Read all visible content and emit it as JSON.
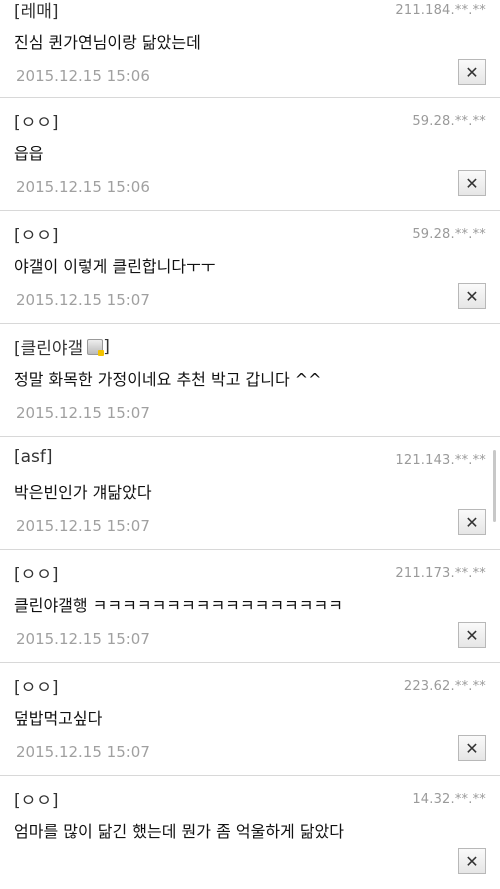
{
  "comments": [
    {
      "author": "[레매]",
      "ip": "211.184.**.**",
      "text": "진심 퀸가연님이랑 닮았는데",
      "date": "2015.12.15 15:06"
    },
    {
      "author": "[ㅇㅇ]",
      "ip": "59.28.**.**",
      "text": "읍읍",
      "date": "2015.12.15 15:06"
    },
    {
      "author": "[ㅇㅇ]",
      "ip": "59.28.**.**",
      "text": "야갤이 이렇게 클린합니다ㅜㅜ",
      "date": "2015.12.15 15:07"
    },
    {
      "author": "[클린야갤",
      "author_suffix": "]",
      "text": "정말 화목한 가정이네요 추천 박고 갑니다 ^^",
      "date": "2015.12.15 15:07"
    },
    {
      "author": "[asf]",
      "ip": "121.143.**.**",
      "text": "박은빈인가 걔닮았다",
      "date": "2015.12.15 15:07"
    },
    {
      "author": "[ㅇㅇ]",
      "ip": "211.173.**.**",
      "text": "클린야갤행 ㅋㅋㅋㅋㅋㅋㅋㅋㅋㅋㅋㅋㅋㅋㅋㅋㅋ",
      "date": "2015.12.15 15:07"
    },
    {
      "author": "[ㅇㅇ]",
      "ip": "223.62.**.**",
      "text": "덮밥먹고싶다",
      "date": "2015.12.15 15:07"
    },
    {
      "author": "[ㅇㅇ]",
      "ip": "14.32.**.**",
      "text": "엄마를 많이 닮긴 했는데 뭔가 좀 억울하게 닮았다",
      "date": ""
    }
  ],
  "delete_label": "✕"
}
